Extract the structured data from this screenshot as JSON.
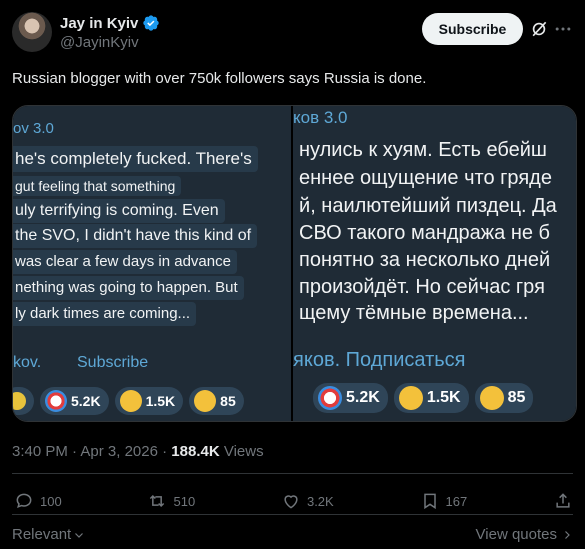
{
  "author": {
    "name": "Jay in Kyiv",
    "handle": "@JayinKyiv"
  },
  "header": {
    "subscribe_label": "Subscribe"
  },
  "tweet": {
    "text": "Russian blogger with over 750k followers says Russia is done."
  },
  "media": {
    "left": {
      "channel": "ov 3.0",
      "lines": [
        "he's completely fucked. There's",
        "gut feeling that something",
        "uly terrifying is coming. Even",
        "the SVO, I didn't have this kind of",
        "was clear a few days in advance",
        "nething was going to happen. But",
        "ly dark times are coming..."
      ],
      "footer_channel": "kov.",
      "footer_subscribe": "Subscribe",
      "reactions": [
        "5.2K",
        "1.5K",
        "85"
      ]
    },
    "right": {
      "channel": "ков 3.0",
      "lines": [
        "нулись к хуям. Есть ебейш",
        "еннее ощущение что гряде",
        "й, наилютейший пиздец. Да",
        "СВО такого мандража не б",
        "понятно за несколько дней",
        "произойдёт. Но сейчас гря",
        "щему тёмные времена..."
      ],
      "footer": "яков. Подписаться",
      "reactions": [
        "5.2K",
        "1.5K",
        "85"
      ]
    }
  },
  "meta": {
    "time": "3:40 PM",
    "sep": "·",
    "date": "Apr 3, 2026",
    "views_count": "188.4K",
    "views_label": "Views"
  },
  "actions": {
    "replies": "100",
    "reposts": "510",
    "likes": "3.2K",
    "bookmarks": "167"
  },
  "footer": {
    "relevant": "Relevant",
    "view_quotes": "View quotes"
  },
  "colors": {
    "verified": "#1d9bf0",
    "panel_bg": "#1f2b36",
    "channel": "#5ea8d6"
  }
}
